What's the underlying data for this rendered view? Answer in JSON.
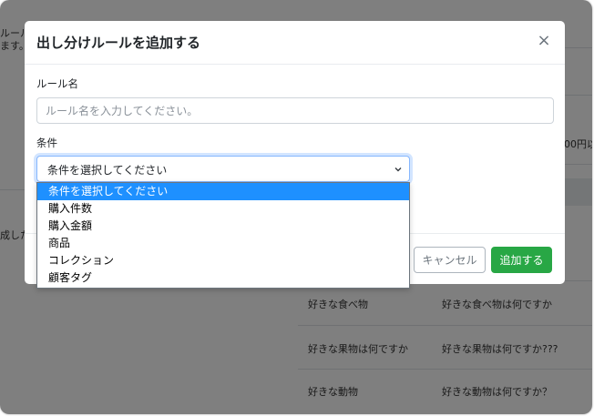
{
  "background": {
    "left_texts": [
      "ルール",
      "ます。",
      "成した"
    ],
    "right_yen": "00円以",
    "rows": [
      {
        "name": "好きな食べ物",
        "question": "好きな食べ物は何ですか"
      },
      {
        "name": "好きな果物は何ですか",
        "question": "好きな果物は何ですか???"
      },
      {
        "name": "好きな動物",
        "question": "好きな動物は何ですか？"
      }
    ]
  },
  "modal": {
    "title": "出し分けルールを追加する",
    "close_glyph": "×",
    "rule_name_label": "ルール名",
    "rule_name_placeholder": "ルール名を入力してください。",
    "rule_name_value": "",
    "condition_label": "条件",
    "condition_selected": "条件を選択してください",
    "cancel_label": "キャンセル",
    "add_label": "追加する"
  },
  "dropdown": {
    "options": [
      "条件を選択してください",
      "購入件数",
      "購入金額",
      "商品",
      "コレクション",
      "顧客タグ"
    ],
    "selected_index": 0
  },
  "colors": {
    "primary_highlight": "#1e90ff",
    "success": "#28a745",
    "overlay": "rgba(0,0,0,0.5)"
  }
}
